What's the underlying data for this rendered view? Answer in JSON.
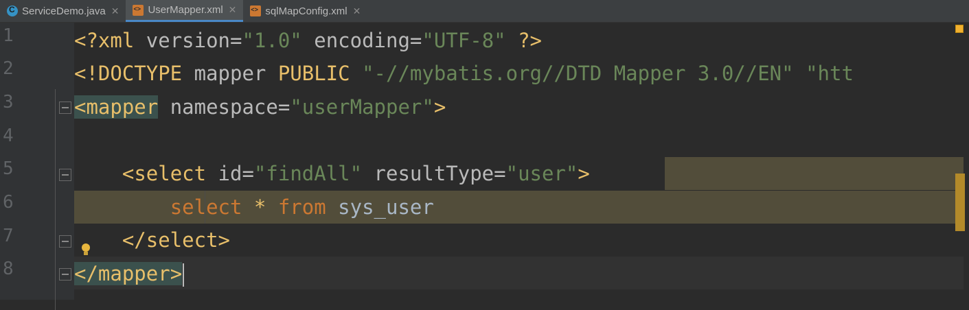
{
  "tabs": [
    {
      "label": "ServiceDemo.java",
      "icon": "java-class-icon",
      "active": false
    },
    {
      "label": "UserMapper.xml",
      "icon": "xml-file-icon",
      "active": true
    },
    {
      "label": "sqlMapConfig.xml",
      "icon": "xml-file-icon",
      "active": false
    }
  ],
  "close_glyph": "✕",
  "line_numbers": [
    "1",
    "2",
    "3",
    "4",
    "5",
    "6",
    "7",
    "8"
  ],
  "code": {
    "l1": {
      "open": "<?",
      "name": "xml",
      "a1": " version",
      "eq1": "=",
      "v1": "\"1.0\"",
      "a2": " encoding",
      "eq2": "=",
      "v2": "\"UTF-8\"",
      "close": " ?>"
    },
    "l2": {
      "open": "<!",
      "name": "DOCTYPE",
      "sp": " mapper ",
      "kw": "PUBLIC",
      "sp2": " ",
      "v1": "\"-//mybatis.org//DTD Mapper 3.0//EN\"",
      "sp3": " ",
      "v2": "\"htt"
    },
    "l3": {
      "open": "<",
      "name": "mapper",
      "a1": " namespace",
      "eq": "=",
      "v1": "\"userMapper\"",
      "close": ">"
    },
    "l5": {
      "indent": "    ",
      "open": "<",
      "name": "select",
      "a1": " id",
      "eq1": "=",
      "v1": "\"findAll\"",
      "a2": " resultType",
      "eq2": "=",
      "v2": "\"user\"",
      "close": ">"
    },
    "l6": {
      "indent": "        ",
      "k1": "select",
      "star": " * ",
      "k2": "from",
      "table": " sys_user"
    },
    "l7": {
      "indent": "    ",
      "open": "</",
      "name": "select",
      "close": ">"
    },
    "l8": {
      "open": "</",
      "name": "mapper",
      "close": ">"
    }
  },
  "colors": {
    "tag": "#e8bf6a",
    "value": "#6a8759",
    "keyword": "#cc7832",
    "text": "#a9b7c6",
    "background": "#2b2b2b"
  }
}
